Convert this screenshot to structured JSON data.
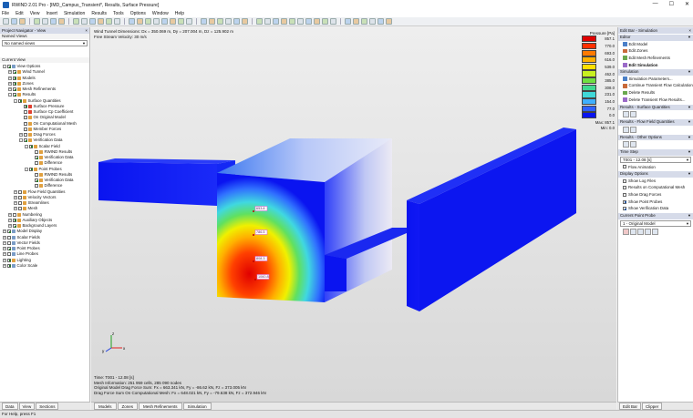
{
  "window": {
    "title": "RWIND 2.01 Pro - [IMD_Campus_Transient*, Results, Surface Pressure]",
    "minimize": "—",
    "maximize": "☐",
    "close": "✕"
  },
  "menu": [
    "File",
    "Edit",
    "View",
    "Insert",
    "Simulation",
    "Results",
    "Tools",
    "Options",
    "Window",
    "Help"
  ],
  "navigator": {
    "title": "Project Navigator - View",
    "named_views_label": "Named Views",
    "named_views_value": "No named views",
    "current_view_label": "Current View",
    "tree": [
      {
        "label": "View Options",
        "d": 0,
        "exp": "-",
        "cb": true,
        "ic": "#7a9cc6"
      },
      {
        "label": "Wind Tunnel",
        "d": 1,
        "exp": "+",
        "cb": true,
        "ic": "#e0a040"
      },
      {
        "label": "Models",
        "d": 1,
        "exp": "+",
        "cb": true,
        "ic": "#e0a040"
      },
      {
        "label": "Zones",
        "d": 1,
        "exp": "+",
        "cb": true,
        "ic": "#e0a040"
      },
      {
        "label": "Mesh Refinements",
        "d": 1,
        "exp": "+",
        "cb": true,
        "ic": "#e0a040"
      },
      {
        "label": "Results",
        "d": 1,
        "exp": "-",
        "cb": true,
        "ic": "#e0a040"
      },
      {
        "label": "Surface Quantities",
        "d": 2,
        "exp": "-",
        "cb": true,
        "ic": "#e0a040"
      },
      {
        "label": "Surface Pressure",
        "d": 3,
        "exp": "",
        "cb": true,
        "ic": "#e04030"
      },
      {
        "label": "Surface Cp Coefficient",
        "d": 3,
        "exp": "",
        "cb": false,
        "ic": "#e04030"
      },
      {
        "label": "On Original Model",
        "d": 3,
        "exp": "",
        "cb": false,
        "ic": "#e0a040"
      },
      {
        "label": "On Computational Mesh",
        "d": 3,
        "exp": "",
        "cb": false,
        "ic": "#e0a040"
      },
      {
        "label": "Member Forces",
        "d": 3,
        "exp": "",
        "cb": false,
        "ic": "#e0a040"
      },
      {
        "label": "Drag Forces",
        "d": 3,
        "exp": "+",
        "cb": false,
        "ic": "#e0a040"
      },
      {
        "label": "Verification Data",
        "d": 3,
        "exp": "-",
        "cb": true,
        "ic": "#e0a040"
      },
      {
        "label": "Scalar Field",
        "d": 4,
        "exp": "-",
        "cb": true,
        "ic": "#e0a040"
      },
      {
        "label": "RWIND Results",
        "d": 5,
        "exp": "",
        "cb": false,
        "ic": "#e0a040"
      },
      {
        "label": "Verification Data",
        "d": 5,
        "exp": "",
        "cb": true,
        "ic": "#e0a040"
      },
      {
        "label": "Difference",
        "d": 5,
        "exp": "",
        "cb": false,
        "ic": "#e0a040"
      },
      {
        "label": "Point Probes",
        "d": 4,
        "exp": "-",
        "cb": true,
        "ic": "#e0a040"
      },
      {
        "label": "RWIND Results",
        "d": 5,
        "exp": "",
        "cb": false,
        "ic": "#e0a040"
      },
      {
        "label": "Verification Data",
        "d": 5,
        "exp": "",
        "cb": true,
        "ic": "#e0a040"
      },
      {
        "label": "Difference",
        "d": 5,
        "exp": "",
        "cb": false,
        "ic": "#e0a040"
      },
      {
        "label": "Flow Field Quantities",
        "d": 2,
        "exp": "+",
        "cb": false,
        "ic": "#e0a040"
      },
      {
        "label": "Velocity Vectors",
        "d": 2,
        "exp": "+",
        "cb": false,
        "ic": "#e0a040"
      },
      {
        "label": "Streamlines",
        "d": 2,
        "exp": "+",
        "cb": false,
        "ic": "#e0a040"
      },
      {
        "label": "Mesh",
        "d": 2,
        "exp": "+",
        "cb": false,
        "ic": "#e0a040"
      },
      {
        "label": "Numbering",
        "d": 1,
        "exp": "+",
        "cb": false,
        "ic": "#e0a040"
      },
      {
        "label": "Auxiliary Objects",
        "d": 1,
        "exp": "+",
        "cb": true,
        "ic": "#e0a040"
      },
      {
        "label": "Background Layers",
        "d": 1,
        "exp": "+",
        "cb": true,
        "ic": "#e0a040"
      },
      {
        "label": "Model Display",
        "d": 0,
        "exp": "+",
        "cb": true,
        "ic": "#7a9cc6"
      },
      {
        "label": "Scalar Fields",
        "d": 0,
        "exp": "+",
        "cb": false,
        "ic": "#7a9cc6"
      },
      {
        "label": "Vector Fields",
        "d": 0,
        "exp": "+",
        "cb": false,
        "ic": "#7a9cc6"
      },
      {
        "label": "Point Probes",
        "d": 0,
        "exp": "+",
        "cb": true,
        "ic": "#7a9cc6"
      },
      {
        "label": "Line Probes",
        "d": 0,
        "exp": "+",
        "cb": false,
        "ic": "#7a9cc6"
      },
      {
        "label": "Lighting",
        "d": 0,
        "exp": "+",
        "cb": true,
        "ic": "#e0a040"
      },
      {
        "label": "Color Scale",
        "d": 0,
        "exp": "+",
        "cb": true,
        "ic": "#7a9cc6"
      }
    ],
    "tabs": [
      "Data",
      "View",
      "Sections"
    ]
  },
  "viewport": {
    "info_top": [
      "Wind Tunnel Dimensions: Dx = 350.069 m, Dy = 207.004 m, Dz = 125.902 m",
      "Free Stream Velocity: 30 m/s"
    ],
    "info_bottom": [
      "Time: T001 - 12.08 [s]",
      "Mesh Information: 251 959 cells, 285 090 nodes",
      "Original Model Drag Force Sum: Fx = 663.341 kN, Fy = -86.62 kN, Fz = 373.005 kN",
      "Drag Force Sum On Computational Mesh: Fx = 648.021 kN, Fy = -79.638 kN, Fz = 372.946 kN"
    ],
    "probes": [
      {
        "label": "653.8",
        "color": "#d46cd4"
      },
      {
        "label": "786.5",
        "color": "#d46cd4"
      },
      {
        "label": "808.3",
        "color": "#d46cd4"
      },
      {
        "label": "1060.8",
        "color": "#d46cd4"
      }
    ],
    "axes": {
      "x": "x",
      "y": "y",
      "z": "z"
    },
    "tabs": [
      "Models",
      "Zones",
      "Mesh Refinements",
      "Simulation"
    ]
  },
  "legend": {
    "title": "Pressure [Pa]",
    "entries": [
      {
        "value": "857.1",
        "color": "#e00000"
      },
      {
        "value": "770.0",
        "color": "#ff3000"
      },
      {
        "value": "693.0",
        "color": "#ff7a00"
      },
      {
        "value": "616.0",
        "color": "#ffb000"
      },
      {
        "value": "539.0",
        "color": "#ffe000"
      },
      {
        "value": "462.0",
        "color": "#c8f020"
      },
      {
        "value": "385.0",
        "color": "#70e040"
      },
      {
        "value": "308.0",
        "color": "#40d890"
      },
      {
        "value": "231.0",
        "color": "#40d8d8"
      },
      {
        "value": "154.0",
        "color": "#40b0ff"
      },
      {
        "value": "77.0",
        "color": "#3060ff"
      },
      {
        "value": "0.0",
        "color": "#0a14f0"
      }
    ],
    "max_label": "Max:",
    "max_value": "857.1",
    "min_label": "Min:",
    "min_value": "0.0"
  },
  "editbar": {
    "title": "Edit Bar - Simulation",
    "sections": [
      {
        "title": "Editor",
        "items": [
          {
            "label": "Edit Model",
            "bold": false
          },
          {
            "label": "Edit Zones",
            "bold": false
          },
          {
            "label": "Edit Mesh Refinements",
            "bold": false
          },
          {
            "label": "Edit Simulation",
            "bold": true
          }
        ]
      },
      {
        "title": "Simulation",
        "items": [
          {
            "label": "Simulation Parameters...",
            "bold": false
          },
          {
            "label": "Continue Transient Flow Calculation",
            "bold": false
          },
          {
            "label": "Delete Results",
            "bold": false
          },
          {
            "label": "Delete Transient Flow Results...",
            "bold": false
          }
        ]
      }
    ],
    "results_surface": "Results - Surface Quantities",
    "results_flow": "Results - Flow Field Quantities",
    "results_other": "Results - Other Options",
    "time_step_label": "Time Step",
    "time_step_value": "T001 - 12.08 [s]",
    "flow_animation": "Flow Animation",
    "display_options": "Display Options",
    "display_items": [
      {
        "label": "Show Log Files",
        "on": false
      },
      {
        "label": "Results on Computational Mesh",
        "on": false
      },
      {
        "label": "Show Drag Forces",
        "on": false
      },
      {
        "label": "Show Point Probes",
        "on": true
      },
      {
        "label": "Show Verification Data",
        "on": true
      }
    ],
    "current_probe_label": "Current Point Probe",
    "current_probe_value": "1 - Original Model",
    "tabs": [
      "Edit Bar",
      "Clipper"
    ]
  },
  "status": "For Help, press F1"
}
